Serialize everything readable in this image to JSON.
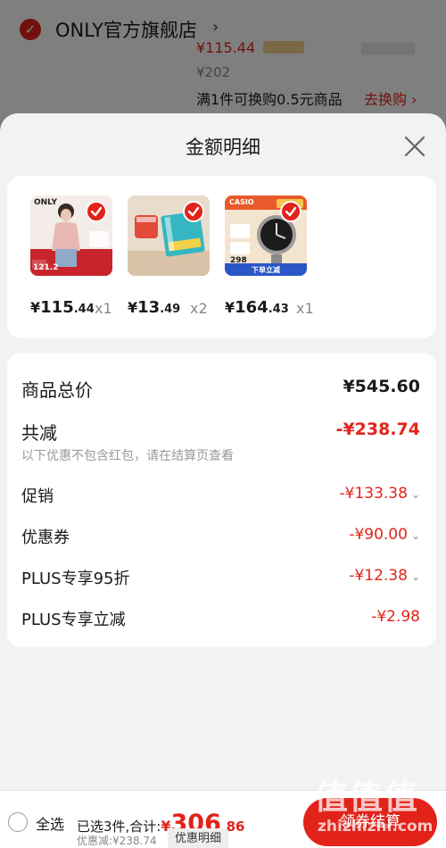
{
  "background": {
    "store_name": "ONLY官方旗舰店",
    "price_partial": "¥115.44",
    "old_price": "¥202",
    "promo_text": "满1件可换购0.5元商品",
    "swap_link": "去换购 ›"
  },
  "sheet": {
    "title": "金额明细",
    "products": [
      {
        "price_int": "115",
        "price_dec": ".44",
        "qty": "x1",
        "logo": "ONLY",
        "badge": "121.2"
      },
      {
        "price_int": "13",
        "price_dec": ".49",
        "qty": "x2"
      },
      {
        "price_int": "164",
        "price_dec": ".43",
        "qty": "x1",
        "logo": "CASIO",
        "badge": "298",
        "banner": "下单立减"
      }
    ],
    "currency": "¥",
    "summary": {
      "total_label": "商品总价",
      "total_value": "¥545.60",
      "reduce_label": "共减",
      "reduce_value": "-¥238.74",
      "reduce_note": "以下优惠不包含红包，请在结算页查看",
      "items": [
        {
          "label": "促销",
          "value": "-¥133.38",
          "expandable": true
        },
        {
          "label": "优惠券",
          "value": "-¥90.00",
          "expandable": true
        },
        {
          "label": "PLUS专享95折",
          "value": "-¥12.38",
          "expandable": true
        },
        {
          "label": "PLUS专享立减",
          "value": "-¥2.98",
          "expandable": false
        }
      ]
    }
  },
  "bottom_bar": {
    "select_all": "全选",
    "selected_text": "已选3件,合计:",
    "currency": "¥",
    "total_int": "306",
    "total_dec": ".86",
    "discount_text": "优惠减:¥238.74",
    "detail_button": "优惠明细",
    "checkout_button": "领券结算"
  },
  "watermark": {
    "text": "值值值",
    "url": "zhizhizhi.com"
  },
  "colors": {
    "accent": "#e2231a",
    "overlay": "rgba(0,0,0,0.5)"
  }
}
